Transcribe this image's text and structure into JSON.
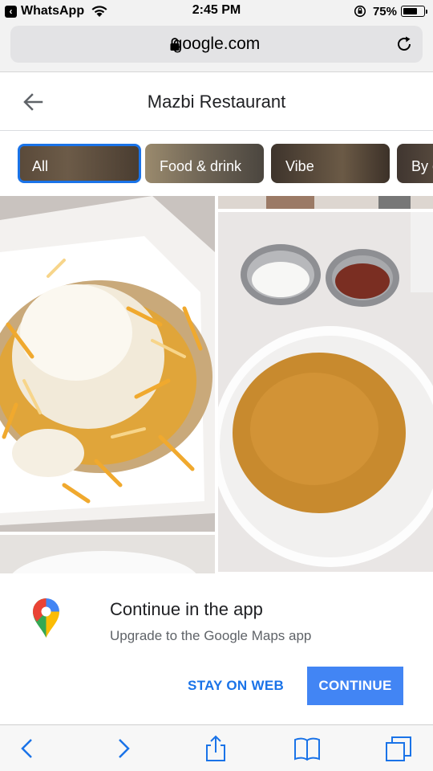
{
  "status_bar": {
    "back_app": "WhatsApp",
    "time": "2:45 PM",
    "battery": "75%",
    "battery_level": 0.75,
    "icons": [
      "back-arrow-icon",
      "wifi-icon",
      "rotation-lock-icon",
      "battery-icon"
    ]
  },
  "browser": {
    "url": "google.com",
    "icons": [
      "lock-icon",
      "reload-icon"
    ]
  },
  "header": {
    "title": "Mazbi Restaurant"
  },
  "chips": [
    {
      "label": "All",
      "active": true
    },
    {
      "label": "Food & drink",
      "active": false
    },
    {
      "label": "Vibe",
      "active": false
    },
    {
      "label": "By o",
      "active": false
    }
  ],
  "sheet": {
    "title": "Continue in the app",
    "subtitle": "Upgrade to the Google Maps app",
    "stay_label": "STAY ON WEB",
    "continue_label": "CONTINUE"
  },
  "toolbar": {
    "icons": [
      "back-icon",
      "forward-icon",
      "share-icon",
      "bookmarks-icon",
      "tabs-icon"
    ]
  },
  "colors": {
    "accent": "#1a73e8",
    "continue_button": "#4285f4"
  }
}
